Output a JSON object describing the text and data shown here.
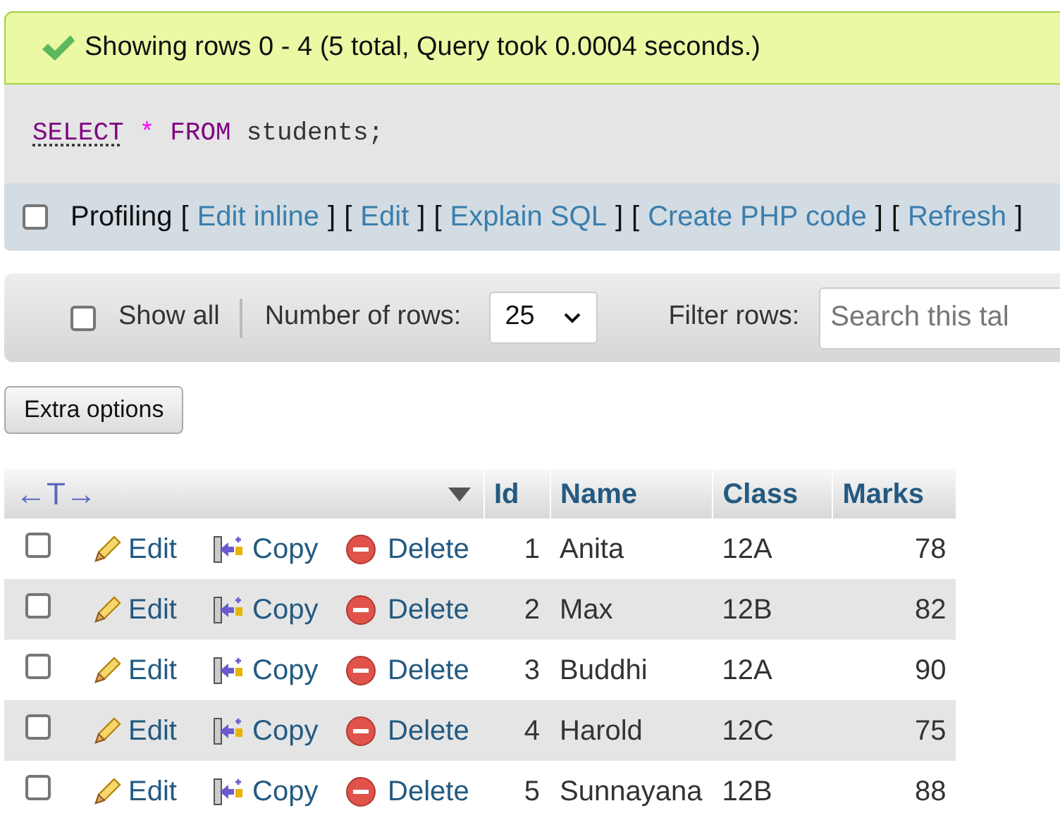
{
  "success_message": "Showing rows 0 - 4 (5 total, Query took 0.0004 seconds.)",
  "sql_query": [
    {
      "kind": "doc_keyword",
      "text": "SELECT"
    },
    {
      "kind": "operator",
      "text": "*"
    },
    {
      "kind": "keyword",
      "text": "FROM"
    },
    {
      "kind": "identifier",
      "text": "students;"
    }
  ],
  "profiling": {
    "label": "Profiling",
    "checked": false,
    "links": [
      {
        "before": "[",
        "label": "Edit inline",
        "after": "]"
      },
      {
        "before": "[",
        "label": "Edit",
        "after": "]"
      },
      {
        "before": "[",
        "label": "Explain SQL",
        "after": "]"
      },
      {
        "before": "[",
        "label": "Create PHP code",
        "after": "]"
      },
      {
        "before": "[",
        "label": "Refresh",
        "after": "]"
      }
    ]
  },
  "navigation": {
    "show_all": {
      "label": "Show all",
      "checked": false
    },
    "rows_label": "Number of rows:",
    "rows_value": "25",
    "filter_label": "Filter rows:",
    "filter_placeholder": "Search this tal"
  },
  "extra_options_button": "Extra options",
  "table": {
    "column_toggle": "←T→",
    "columns": [
      "Id",
      "Name",
      "Class",
      "Marks"
    ],
    "rows": [
      {
        "checked": false,
        "actions": {
          "edit": "Edit",
          "copy": "Copy",
          "delete": "Delete"
        },
        "cells": [
          "1",
          "Anita",
          "12A",
          "78"
        ]
      },
      {
        "checked": false,
        "actions": {
          "edit": "Edit",
          "copy": "Copy",
          "delete": "Delete"
        },
        "cells": [
          "2",
          "Max",
          "12B",
          "82"
        ]
      },
      {
        "checked": false,
        "actions": {
          "edit": "Edit",
          "copy": "Copy",
          "delete": "Delete"
        },
        "cells": [
          "3",
          "Buddhi",
          "12A",
          "90"
        ]
      },
      {
        "checked": false,
        "actions": {
          "edit": "Edit",
          "copy": "Copy",
          "delete": "Delete"
        },
        "cells": [
          "4",
          "Harold",
          "12C",
          "75"
        ]
      },
      {
        "checked": false,
        "actions": {
          "edit": "Edit",
          "copy": "Copy",
          "delete": "Delete"
        },
        "cells": [
          "5",
          "Sunnayana",
          "12B",
          "88"
        ]
      }
    ]
  }
}
